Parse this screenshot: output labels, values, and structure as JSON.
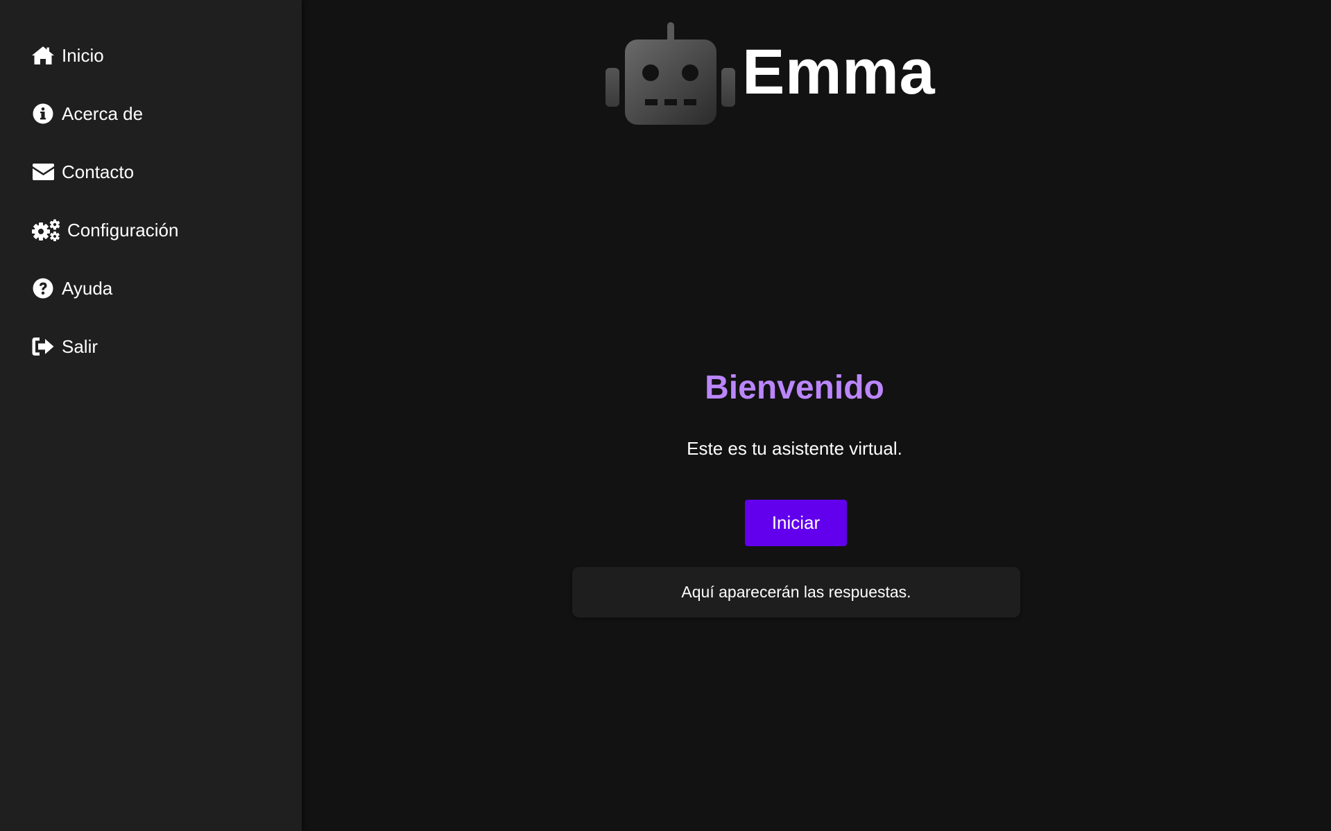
{
  "sidebar": {
    "items": [
      {
        "label": "Inicio",
        "icon": "home-icon"
      },
      {
        "label": "Acerca de",
        "icon": "info-circle-icon"
      },
      {
        "label": "Contacto",
        "icon": "envelope-icon"
      },
      {
        "label": "Configuración",
        "icon": "cogs-icon"
      },
      {
        "label": "Ayuda",
        "icon": "question-circle-icon"
      },
      {
        "label": "Salir",
        "icon": "sign-out-icon"
      }
    ]
  },
  "header": {
    "logo_icon": "robot-icon",
    "brand_name": "Emma"
  },
  "main": {
    "welcome_title": "Bienvenido",
    "subtitle": "Este es tu asistente virtual.",
    "start_button_label": "Iniciar",
    "response_placeholder": "Aquí aparecerán las respuestas."
  },
  "colors": {
    "background": "#121212",
    "sidebar": "#1f1f1f",
    "accent_purple": "#bb86fc",
    "button_purple": "#6200ee",
    "response_box": "#1e1e1e"
  }
}
